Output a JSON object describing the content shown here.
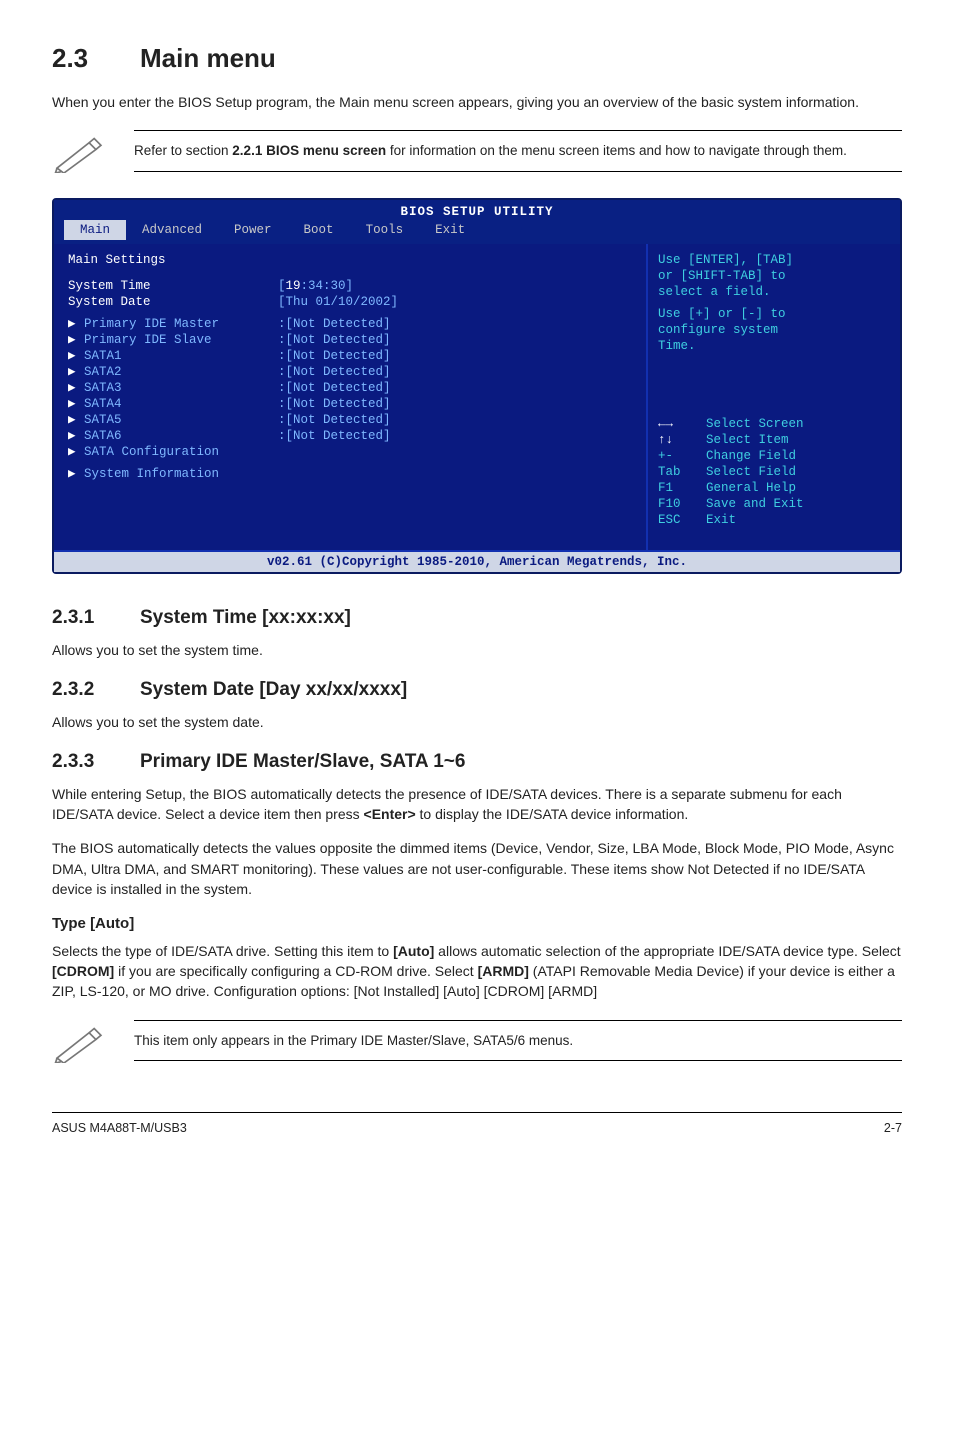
{
  "section": {
    "num": "2.3",
    "title": "Main menu"
  },
  "intro": "When you enter the BIOS Setup program, the Main menu screen appears, giving you an overview of the basic system information.",
  "note1_pre": "Refer to section ",
  "note1_bold": "2.2.1 BIOS menu screen",
  "note1_post": " for information on the menu screen items and how to navigate through them.",
  "bios": {
    "title": "BIOS SETUP UTILITY",
    "tabs": {
      "main": "Main",
      "advanced": "Advanced",
      "power": "Power",
      "boot": "Boot",
      "tools": "Tools",
      "exit": "Exit"
    },
    "heading": "Main Settings",
    "systime_label": "System Time",
    "systime_val_pre": "[",
    "systime_val_hl": "19",
    "systime_val_post": ":34:30]",
    "sysdate_label": "System Date",
    "sysdate_val": "[Thu 01/10/2002]",
    "items": [
      {
        "label": "Primary IDE Master",
        "val": ":[Not Detected]"
      },
      {
        "label": "Primary IDE Slave",
        "val": ":[Not Detected]"
      },
      {
        "label": "SATA1",
        "val": ":[Not Detected]"
      },
      {
        "label": "SATA2",
        "val": ":[Not Detected]"
      },
      {
        "label": "SATA3",
        "val": ":[Not Detected]"
      },
      {
        "label": "SATA4",
        "val": ":[Not Detected]"
      },
      {
        "label": "SATA5",
        "val": ":[Not Detected]"
      },
      {
        "label": "SATA6",
        "val": ":[Not Detected]"
      }
    ],
    "sata_config": "SATA Configuration",
    "sys_info": "System Information",
    "help_top1": "Use [ENTER], [TAB]",
    "help_top2": "or [SHIFT-TAB] to",
    "help_top3": "select a field.",
    "help_mid1": "Use [+] or [-] to",
    "help_mid2": "configure system",
    "help_mid3": "Time.",
    "legend": [
      {
        "k": "←→",
        "t": "Select Screen"
      },
      {
        "k": "↑↓",
        "t": "Select Item"
      },
      {
        "k": "+-",
        "t": "Change Field"
      },
      {
        "k": "Tab",
        "t": "Select Field"
      },
      {
        "k": "F1",
        "t": "General Help"
      },
      {
        "k": "F10",
        "t": "Save and Exit"
      },
      {
        "k": "ESC",
        "t": "Exit"
      }
    ],
    "foot": "v02.61 (C)Copyright 1985-2010, American Megatrends, Inc."
  },
  "s231": {
    "num": "2.3.1",
    "title": "System Time [xx:xx:xx]",
    "body": "Allows you to set the system time."
  },
  "s232": {
    "num": "2.3.2",
    "title": "System Date [Day xx/xx/xxxx]",
    "body": "Allows you to set the system date."
  },
  "s233": {
    "num": "2.3.3",
    "title": "Primary IDE Master/Slave, SATA 1~6",
    "p1a": "While entering Setup, the BIOS automatically detects the presence of IDE/SATA devices. There is a separate submenu for each IDE/SATA device. Select a device item then press ",
    "p1b": "<Enter>",
    "p1c": " to display the IDE/SATA device information.",
    "p2": "The BIOS automatically detects the values opposite the dimmed items (Device, Vendor, Size, LBA Mode, Block Mode, PIO Mode, Async DMA, Ultra DMA, and SMART monitoring). These values are not user-configurable. These items show Not Detected if no IDE/SATA device is installed in the system.",
    "type_h": "Type [Auto]",
    "type_a": "Selects the type of IDE/SATA drive. Setting this item to ",
    "type_b": "[Auto]",
    "type_c": " allows automatic selection of the appropriate IDE/SATA device type. Select ",
    "type_d": "[CDROM]",
    "type_e": " if you are specifically configuring a CD-ROM drive. Select ",
    "type_f": "[ARMD]",
    "type_g": " (ATAPI Removable Media Device) if your device is either a ZIP, LS-120, or MO drive. Configuration options: [Not Installed] [Auto] [CDROM] [ARMD]"
  },
  "note2": "This item only appears in the Primary IDE Master/Slave, SATA5/6 menus.",
  "footer": {
    "left": "ASUS M4A88T-M/USB3",
    "right": "2-7"
  }
}
